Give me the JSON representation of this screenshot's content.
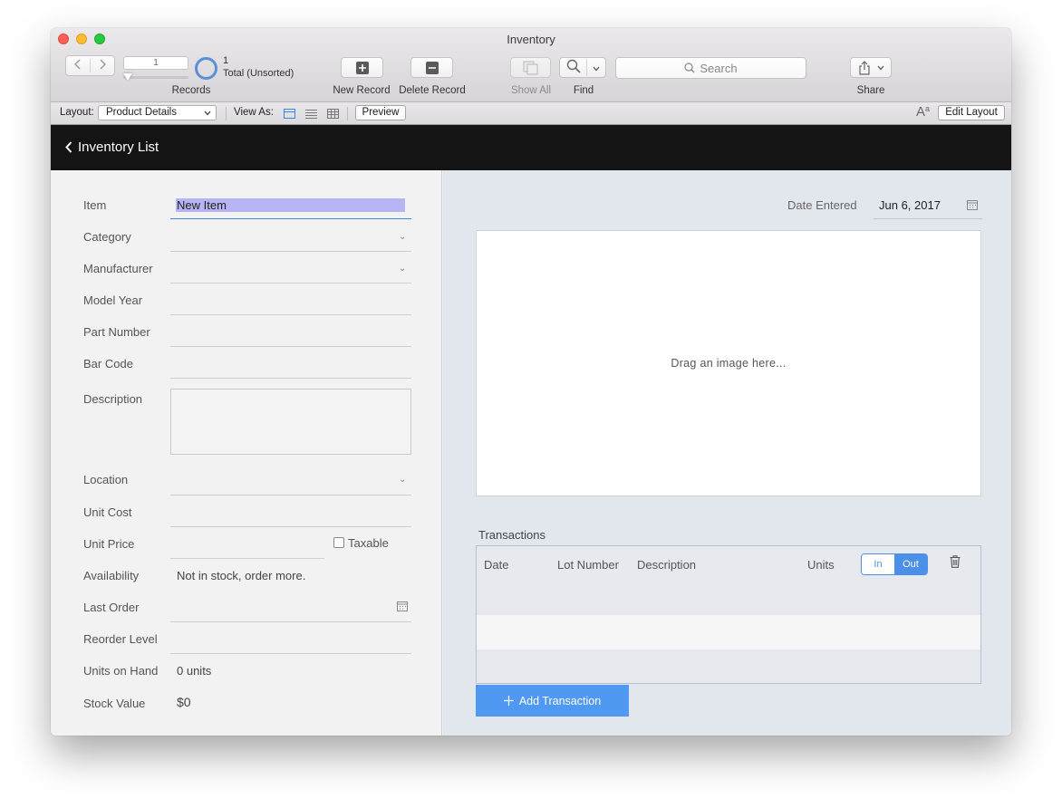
{
  "window": {
    "title": "Inventory"
  },
  "toolbar": {
    "record_number": "1",
    "record_count": "1",
    "record_total": "Total (Unsorted)",
    "records_label": "Records",
    "new_record_label": "New Record",
    "delete_record_label": "Delete Record",
    "show_all_label": "Show All",
    "find_label": "Find",
    "search_placeholder": "Search",
    "share_label": "Share"
  },
  "layoutbar": {
    "layout_label": "Layout:",
    "layout_value": "Product Details",
    "view_as_label": "View As:",
    "preview_label": "Preview",
    "edit_layout_label": "Edit Layout"
  },
  "nav": {
    "back_label": "Inventory List"
  },
  "form": {
    "item_label": "Item",
    "item_value": "New Item",
    "category_label": "Category",
    "manufacturer_label": "Manufacturer",
    "model_year_label": "Model Year",
    "part_number_label": "Part Number",
    "bar_code_label": "Bar Code",
    "description_label": "Description",
    "location_label": "Location",
    "unit_cost_label": "Unit Cost",
    "unit_price_label": "Unit Price",
    "taxable_label": "Taxable",
    "availability_label": "Availability",
    "availability_value": "Not in stock, order more.",
    "last_order_label": "Last Order",
    "reorder_level_label": "Reorder Level",
    "units_on_hand_label": "Units on Hand",
    "units_on_hand_value": "0 units",
    "stock_value_label": "Stock Value",
    "stock_value_value": "$0"
  },
  "right_panel": {
    "date_entered_label": "Date Entered",
    "date_entered_value": "Jun 6, 2017",
    "image_placeholder": "Drag an image here...",
    "transactions_title": "Transactions",
    "columns": [
      "Date",
      "Lot Number",
      "Description",
      "Units"
    ],
    "in_label": "In",
    "out_label": "Out",
    "add_transaction_label": "Add Transaction"
  },
  "colors": {
    "accent": "#4a8fe8",
    "nav_background": "#141414",
    "selection": "#b7b4f3"
  }
}
